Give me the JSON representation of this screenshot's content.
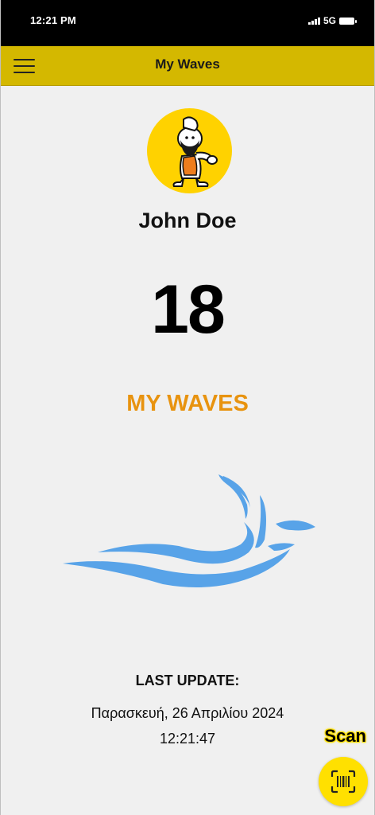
{
  "status_bar": {
    "time": "12:21 PM",
    "network": "5G",
    "icons": [
      "signal-icon",
      "battery-icon"
    ]
  },
  "app_bar": {
    "title": "My Waves",
    "menu_icon": "hamburger-menu-icon",
    "color": "#d4b800"
  },
  "profile": {
    "avatar_icon": "caveman-mascot-avatar",
    "name": "John Doe"
  },
  "waves": {
    "count": "18",
    "title": "MY WAVES",
    "title_color": "#e8930f",
    "wave_color": "#58a3e8"
  },
  "last_update": {
    "label": "LAST UPDATE:",
    "date": "Παρασκευή, 26 Απριλίου 2024",
    "time": "12:21:47"
  },
  "scan": {
    "label": "Scan",
    "icon": "barcode-scan-icon",
    "button_color": "#ffe000"
  }
}
